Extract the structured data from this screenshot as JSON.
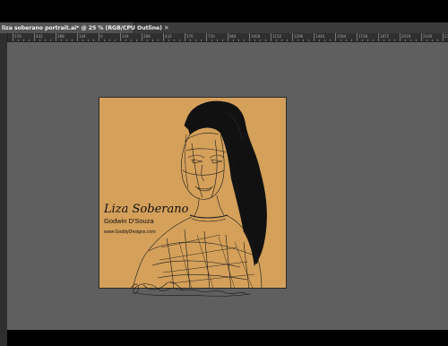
{
  "document_tab": {
    "title": "liza soberano portrait.ai* @ 25 % (RGB/CPU Outline)",
    "close_glyph": "×"
  },
  "ruler": {
    "labels": [
      "576",
      "432",
      "288",
      "144",
      "0",
      "144",
      "288",
      "432",
      "576",
      "720",
      "864",
      "1008",
      "1152",
      "1296",
      "1440",
      "1584",
      "1728",
      "1872",
      "2016",
      "2160",
      "2304"
    ]
  },
  "artwork": {
    "name": "Liza Soberano",
    "artist": "Godwin D'Souza",
    "website": "www.GoddyDesigns.com",
    "background_color": "#d4a05a"
  }
}
